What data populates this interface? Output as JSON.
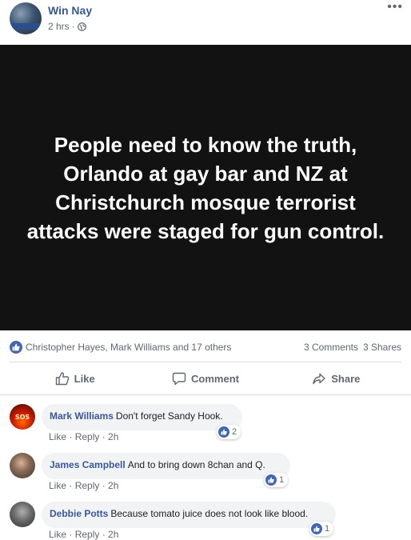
{
  "post": {
    "author": "Win Nay",
    "time": "2 hrs",
    "separator": "·",
    "more": "•••",
    "image_text": "People need to know the truth, Orlando at gay bar and NZ at Christchurch mosque terrorist attacks were staged for gun control."
  },
  "reactions": {
    "reactors": "Christopher Hayes, Mark Williams and 17 others",
    "comments": "3 Comments",
    "shares": "3 Shares"
  },
  "actions": {
    "like": "Like",
    "comment": "Comment",
    "share": "Share"
  },
  "comments": [
    {
      "author": "Mark Williams",
      "text": "Don't forget Sandy Hook.",
      "likes": "2",
      "like_label": "Like",
      "reply_label": "Reply",
      "time": "2h",
      "avatar_text": "SOS"
    },
    {
      "author": "James Campbell",
      "text": "And to bring down 8chan and Q.",
      "likes": "1",
      "like_label": "Like",
      "reply_label": "Reply",
      "time": "2h"
    },
    {
      "author": "Debbie Potts",
      "text": "Because tomato juice does not look like blood.",
      "likes": "1",
      "like_label": "Like",
      "reply_label": "Reply",
      "time": "2h"
    }
  ],
  "colors": {
    "link_blue": "#365899",
    "like_blue": "#4267b2",
    "image_bg": "#121212"
  }
}
